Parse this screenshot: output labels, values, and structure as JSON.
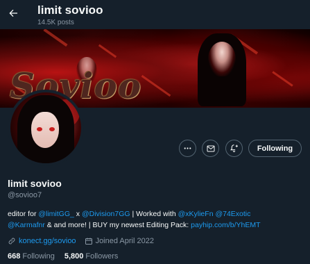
{
  "header": {
    "name": "limit sovioo",
    "post_count": "14.5K posts"
  },
  "banner": {
    "logo_text": "Sovioo"
  },
  "actions": {
    "follow_label": "Following"
  },
  "profile": {
    "display_name": "limit sovioo",
    "handle": "@sovioo7"
  },
  "bio": {
    "t1": "editor for ",
    "m1": "@limitGG_",
    "t2": " x ",
    "m2": "@Division7GG",
    "t3": " | Worked with ",
    "m3": "@xKylieFn",
    "t4": " ",
    "m4": "@74Exotic",
    "t5": " ",
    "m5": "@Karmafnr",
    "t6": " & and more! | BUY my newest Editing Pack: ",
    "l1": "payhip.com/b/YhEMT"
  },
  "meta": {
    "website": "konect.gg/sovioo",
    "joined": "Joined April 2022"
  },
  "counts": {
    "following_num": "668",
    "following_label": "Following",
    "followers_num": "5,800",
    "followers_label": "Followers"
  },
  "colors": {
    "background": "#15202b",
    "accent": "#1d9bf0",
    "secondary_text": "#8b98a5",
    "border": "#536471"
  }
}
